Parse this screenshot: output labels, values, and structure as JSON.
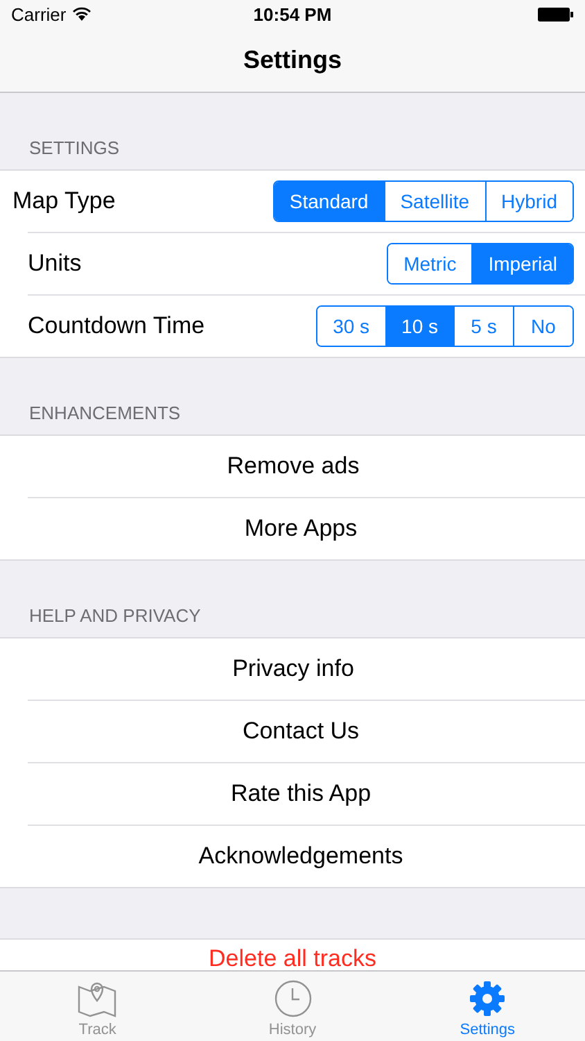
{
  "status_bar": {
    "carrier": "Carrier",
    "time": "10:54 PM"
  },
  "nav": {
    "title": "Settings"
  },
  "sections": [
    {
      "header": "SETTINGS",
      "rows": [
        {
          "kind": "segmented",
          "label": "Map Type",
          "options": [
            {
              "label": "Standard",
              "selected": true
            },
            {
              "label": "Satellite",
              "selected": false
            },
            {
              "label": "Hybrid",
              "selected": false
            }
          ]
        },
        {
          "kind": "segmented",
          "label": "Units",
          "options": [
            {
              "label": "Metric",
              "selected": false
            },
            {
              "label": "Imperial",
              "selected": true
            }
          ]
        },
        {
          "kind": "segmented",
          "label": "Countdown Time",
          "options": [
            {
              "label": "30 s",
              "selected": false
            },
            {
              "label": "10 s",
              "selected": true
            },
            {
              "label": "5 s",
              "selected": false
            },
            {
              "label": "No",
              "selected": false
            }
          ]
        }
      ]
    },
    {
      "header": "ENHANCEMENTS",
      "rows": [
        {
          "kind": "action",
          "label": "Remove ads"
        },
        {
          "kind": "action",
          "label": "More Apps"
        }
      ]
    },
    {
      "header": "HELP AND PRIVACY",
      "rows": [
        {
          "kind": "action",
          "label": "Privacy info"
        },
        {
          "kind": "action",
          "label": "Contact Us"
        },
        {
          "kind": "action",
          "label": "Rate this App"
        },
        {
          "kind": "action",
          "label": "Acknowledgements"
        }
      ]
    },
    {
      "rows": [
        {
          "kind": "destructive",
          "label": "Delete all tracks"
        }
      ]
    }
  ],
  "tab_bar": [
    {
      "kind": "track",
      "label": "Track",
      "selected": false
    },
    {
      "kind": "history",
      "label": "History",
      "selected": false
    },
    {
      "kind": "settings",
      "label": "Settings",
      "selected": true
    }
  ]
}
